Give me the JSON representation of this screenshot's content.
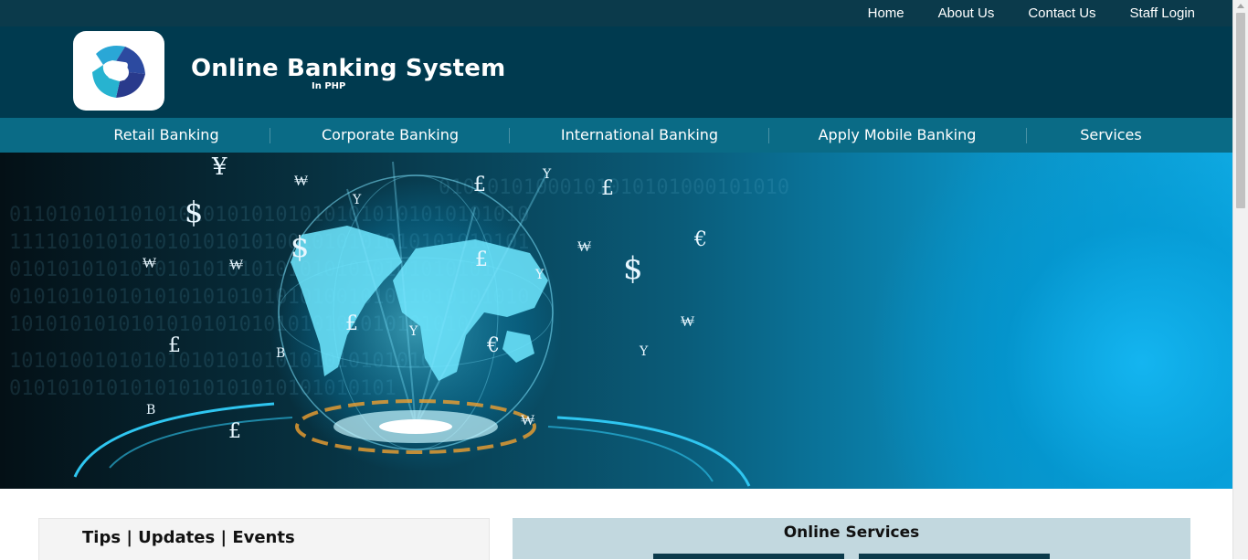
{
  "topnav": {
    "home": "Home",
    "about": "About Us",
    "contact": "Contact Us",
    "staff_login": "Staff Login"
  },
  "header": {
    "title": "Online Banking System",
    "subtitle": "In PHP",
    "logo_icon": "bank-logo-icon"
  },
  "mainnav": {
    "items": [
      {
        "label": "Retail Banking"
      },
      {
        "label": "Corporate Banking"
      },
      {
        "label": "International Banking"
      },
      {
        "label": "Apply Mobile Banking"
      },
      {
        "label": "Services"
      }
    ]
  },
  "hero": {
    "image": "global-currency-banner",
    "symbols": [
      "¥",
      "₩",
      "Y",
      "£",
      "£",
      "Y",
      "$",
      "$",
      "₩",
      "₩",
      "₩",
      "€",
      "$",
      "£",
      "Y",
      "₩",
      "£",
      "€",
      "B",
      "Y",
      "Y",
      "B",
      "£",
      "£",
      "₩"
    ]
  },
  "tips": {
    "heading": "Tips | Updates | Events"
  },
  "services": {
    "heading": "Online Services"
  },
  "colors": {
    "topbar": "#0b3a4b",
    "header": "#003a4f",
    "mainnav": "#0a6b86",
    "services_panel": "#c2d8df"
  }
}
